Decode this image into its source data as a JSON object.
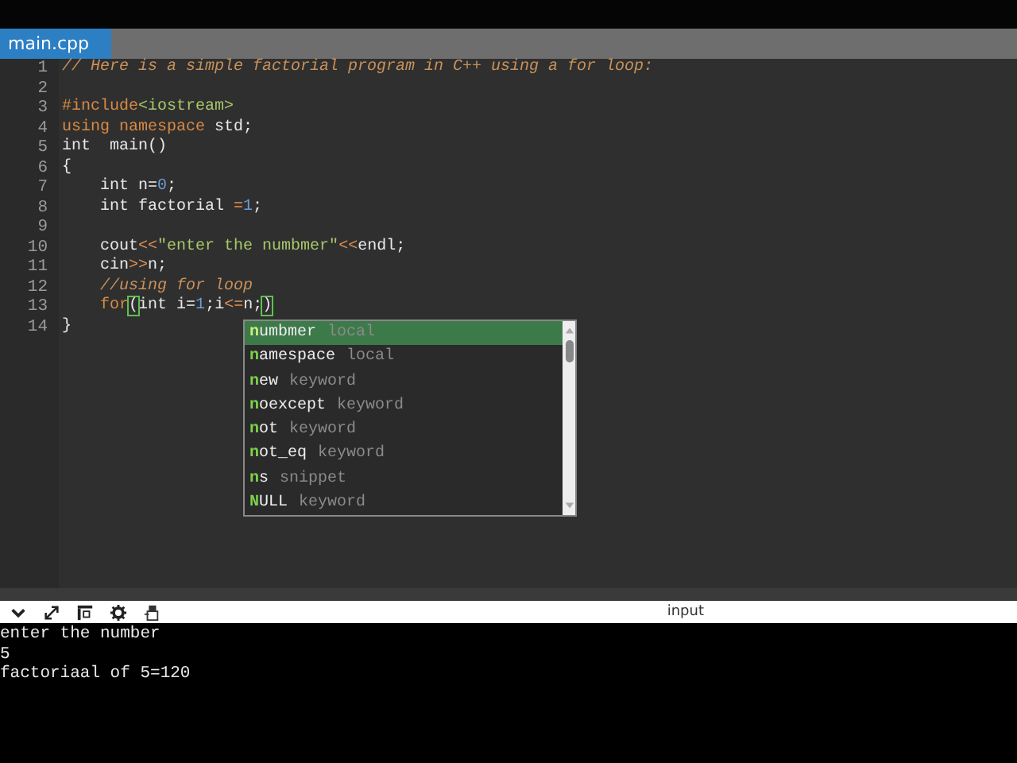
{
  "tabs": [
    {
      "label": "main.cpp",
      "selected": true
    }
  ],
  "code_lines": [
    {
      "number": "1",
      "indent": false,
      "tokens": [
        {
          "kind": "comment",
          "text": "// Here is a simple factorial program in C++ using a for loop:"
        }
      ]
    },
    {
      "number": "2"
    },
    {
      "number": "3",
      "indent": false,
      "tokens": [
        {
          "kind": "keyword",
          "text": "#include"
        },
        {
          "kind": "string",
          "text": "<iostream>"
        }
      ]
    },
    {
      "number": "4",
      "indent": false,
      "tokens": [
        {
          "kind": "keyword",
          "text": "using namespace"
        },
        {
          "kind": "plain",
          "text": " std;"
        }
      ]
    },
    {
      "number": "5",
      "indent": false,
      "tokens": [
        {
          "kind": "plain",
          "text": "int  main()"
        }
      ]
    },
    {
      "number": "6",
      "indent": false,
      "tokens": [
        {
          "kind": "plain",
          "text": "{"
        }
      ]
    },
    {
      "number": "7",
      "indent": true,
      "tokens": [
        {
          "kind": "plain",
          "text": "int n="
        },
        {
          "kind": "number",
          "text": "0"
        },
        {
          "kind": "plain",
          "text": ";"
        }
      ]
    },
    {
      "number": "8",
      "indent": true,
      "tokens": [
        {
          "kind": "plain",
          "text": "int factorial "
        },
        {
          "kind": "operator",
          "text": "="
        },
        {
          "kind": "number",
          "text": "1"
        },
        {
          "kind": "plain",
          "text": ";"
        }
      ]
    },
    {
      "number": "9"
    },
    {
      "number": "10",
      "indent": true,
      "tokens": [
        {
          "kind": "plain",
          "text": "cout"
        },
        {
          "kind": "operator",
          "text": "<<"
        },
        {
          "kind": "string",
          "text": "\"enter the numbmer\""
        },
        {
          "kind": "operator",
          "text": "<<"
        },
        {
          "kind": "plain",
          "text": "endl;"
        }
      ]
    },
    {
      "number": "11",
      "indent": true,
      "tokens": [
        {
          "kind": "plain",
          "text": "cin"
        },
        {
          "kind": "operator",
          "text": ">>"
        },
        {
          "kind": "plain",
          "text": "n;"
        }
      ]
    },
    {
      "number": "12",
      "indent": true,
      "tokens": [
        {
          "kind": "comment",
          "text": "//using for loop"
        }
      ]
    },
    {
      "number": "13",
      "indent": true,
      "tokens": [
        {
          "kind": "keyword",
          "text": "for"
        },
        {
          "kind": "match",
          "text": "("
        },
        {
          "kind": "plain",
          "text": "int i="
        },
        {
          "kind": "number",
          "text": "1"
        },
        {
          "kind": "plain",
          "text": ";i"
        },
        {
          "kind": "operator",
          "text": "<="
        },
        {
          "kind": "plain",
          "text": "n;"
        },
        {
          "kind": "match",
          "text": ")"
        }
      ]
    },
    {
      "number": "14",
      "indent": false,
      "tokens": [
        {
          "kind": "plain",
          "text": "}"
        }
      ]
    }
  ],
  "autocomplete": [
    {
      "match": "n",
      "rest": "umbmer",
      "type": "local",
      "selected": true
    },
    {
      "match": "n",
      "rest": "amespace",
      "type": "local",
      "selected": false
    },
    {
      "match": "n",
      "rest": "ew",
      "type": "keyword",
      "selected": false
    },
    {
      "match": "n",
      "rest": "oexcept",
      "type": "keyword",
      "selected": false
    },
    {
      "match": "n",
      "rest": "ot",
      "type": "keyword",
      "selected": false
    },
    {
      "match": "n",
      "rest": "ot_eq",
      "type": "keyword",
      "selected": false
    },
    {
      "match": "n",
      "rest": "s",
      "type": "snippet",
      "selected": false
    },
    {
      "match": "N",
      "rest": "ULL",
      "type": "keyword",
      "selected": false
    }
  ],
  "console": {
    "title": "input",
    "lines": [
      "enter the number",
      "5",
      "factoriaal of 5=120"
    ]
  }
}
